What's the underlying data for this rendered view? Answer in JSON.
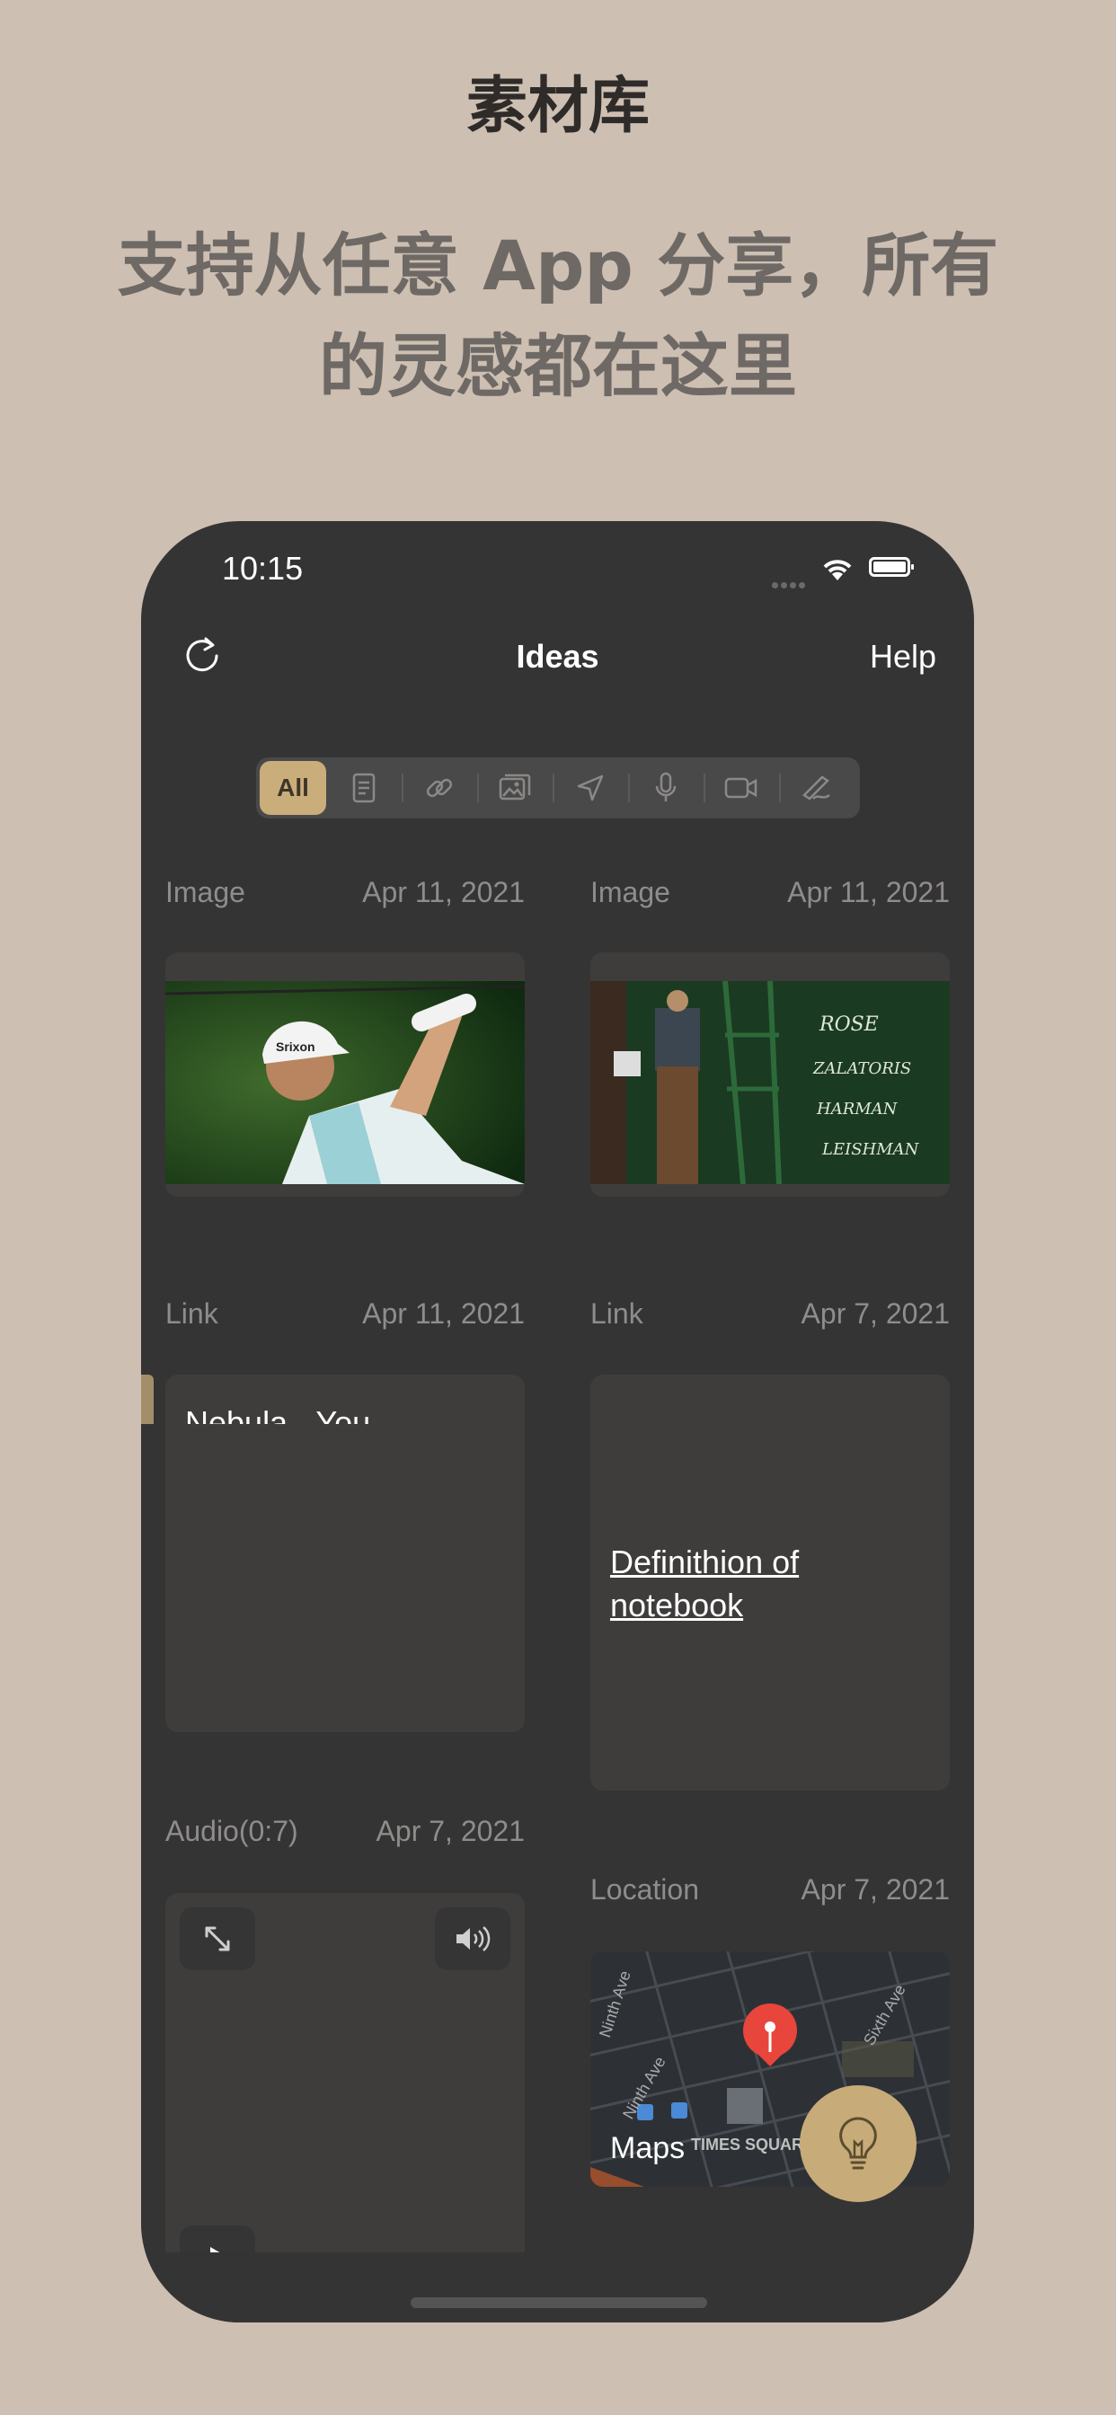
{
  "promo": {
    "headline": "素材库",
    "subhead": "支持从任意 App 分享，所有的灵感都在这里"
  },
  "status_bar": {
    "time": "10:15"
  },
  "nav": {
    "title": "Ideas",
    "help": "Help",
    "refresh_icon": "refresh-icon"
  },
  "filters": [
    {
      "label": "All",
      "icon": "all",
      "active": true
    },
    {
      "icon": "document-icon"
    },
    {
      "icon": "link-icon"
    },
    {
      "icon": "image-icon"
    },
    {
      "icon": "location-icon"
    },
    {
      "icon": "microphone-icon"
    },
    {
      "icon": "video-icon"
    },
    {
      "icon": "handwriting-icon"
    }
  ],
  "cards": [
    {
      "type": "Image",
      "date": "Apr 11, 2021",
      "content": "golfer photo"
    },
    {
      "type": "Image",
      "date": "Apr 11, 2021",
      "content": "scoreboard photo"
    },
    {
      "type": "Link",
      "date": "Apr 11, 2021",
      "text": "Nebula - You Personal Knowledge System - text editor, user guide, feature request, issue report, anything want to share"
    },
    {
      "type": "Link",
      "date": "Apr 7, 2021",
      "text": "Definithion of notebook"
    },
    {
      "type": "Audio(0:7)",
      "date": "Apr 7, 2021"
    },
    {
      "type": "Location",
      "date": "Apr 7, 2021",
      "map_brand": "Maps",
      "map_label": "TIMES SQUARE",
      "streets": [
        "Ninth Ave",
        "Ninth Ave",
        "Sixth Ave"
      ]
    }
  ],
  "colors": {
    "accent": "#c9ad7b",
    "background": "#cdbfb2",
    "phone": "#353434"
  }
}
